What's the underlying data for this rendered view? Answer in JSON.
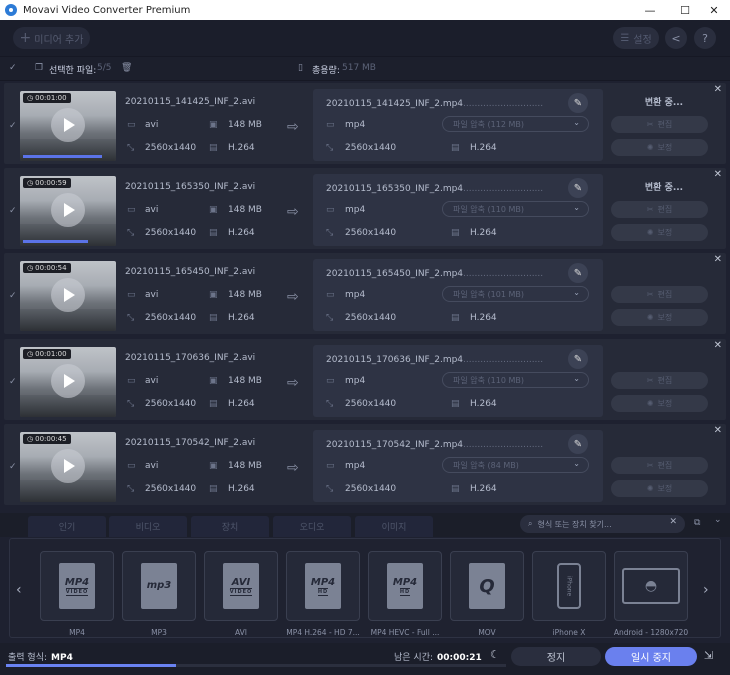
{
  "window": {
    "title": "Movavi Video Converter Premium",
    "minimize": "—",
    "maximize": "☐",
    "close": "✕"
  },
  "toolbar": {
    "add_media": "미디어 추가",
    "settings": "설정"
  },
  "selection": {
    "selected_label": "선택한 파일:",
    "selected_value": "5/5",
    "total_label": "총용량:",
    "total_value": "517 MB"
  },
  "files": [
    {
      "duration": "00:01:00",
      "name": "20210115_141425_INF_2.avi",
      "format": "avi",
      "size": "148 MB",
      "resolution": "2560x1440",
      "codec": "H.264",
      "out_name": "20210115_141425_INF_2.mp4",
      "out_format": "mp4",
      "compress": "파일 압축 (112 MB)",
      "out_resolution": "2560x1440",
      "out_codec": "H.264",
      "status": "변환 중...",
      "edit": "편집",
      "enhance": "보정",
      "progress": 0.88
    },
    {
      "duration": "00:00:59",
      "name": "20210115_165350_INF_2.avi",
      "format": "avi",
      "size": "148 MB",
      "resolution": "2560x1440",
      "codec": "H.264",
      "out_name": "20210115_165350_INF_2.mp4",
      "out_format": "mp4",
      "compress": "파일 압축 (110 MB)",
      "out_resolution": "2560x1440",
      "out_codec": "H.264",
      "status": "변환 중...",
      "edit": "편집",
      "enhance": "보정",
      "progress": 0.72
    },
    {
      "duration": "00:00:54",
      "name": "20210115_165450_INF_2.avi",
      "format": "avi",
      "size": "148 MB",
      "resolution": "2560x1440",
      "codec": "H.264",
      "out_name": "20210115_165450_INF_2.mp4",
      "out_format": "mp4",
      "compress": "파일 압축 (101 MB)",
      "out_resolution": "2560x1440",
      "out_codec": "H.264",
      "status": "",
      "edit": "편집",
      "enhance": "보정",
      "progress": 0
    },
    {
      "duration": "00:01:00",
      "name": "20210115_170636_INF_2.avi",
      "format": "avi",
      "size": "148 MB",
      "resolution": "2560x1440",
      "codec": "H.264",
      "out_name": "20210115_170636_INF_2.mp4",
      "out_format": "mp4",
      "compress": "파일 압축 (110 MB)",
      "out_resolution": "2560x1440",
      "out_codec": "H.264",
      "status": "",
      "edit": "편집",
      "enhance": "보정",
      "progress": 0
    },
    {
      "duration": "00:00:45",
      "name": "20210115_170542_INF_2.avi",
      "format": "avi",
      "size": "148 MB",
      "resolution": "2560x1440",
      "codec": "H.264",
      "out_name": "20210115_170542_INF_2.mp4",
      "out_format": "mp4",
      "compress": "파일 압축 (84 MB)",
      "out_resolution": "2560x1440",
      "out_codec": "H.264",
      "status": "",
      "edit": "편집",
      "enhance": "보정",
      "progress": 0
    }
  ],
  "tabs": [
    "인기",
    "비디오",
    "장치",
    "오디오",
    "이미지"
  ],
  "search": {
    "placeholder": "형식 또는 장치 찾기..."
  },
  "formats": [
    {
      "label": "MP4",
      "icon": "MP4",
      "sub": "VIDEO"
    },
    {
      "label": "MP3",
      "icon": "mp3",
      "sub": ""
    },
    {
      "label": "AVI",
      "icon": "AVI",
      "sub": "VIDEO"
    },
    {
      "label": "MP4 H.264 - HD 7...",
      "icon": "MP4",
      "sub": "HD"
    },
    {
      "label": "MP4 HEVC - Full ...",
      "icon": "MP4",
      "sub": "HD"
    },
    {
      "label": "MOV",
      "icon": "Q",
      "sub": ""
    },
    {
      "label": "iPhone X",
      "icon": "iPhone",
      "sub": ""
    },
    {
      "label": "Android - 1280x720",
      "icon": "android",
      "sub": ""
    }
  ],
  "bottom": {
    "output_label": "출력 형식:",
    "output_value": "MP4",
    "remaining_label": "남은 시간:",
    "remaining_value": "00:00:21",
    "stop": "정지",
    "pause": "일시 중지",
    "total_progress": 0.34
  },
  "colors": {
    "accent": "#6a80ee",
    "background": "#1e2130",
    "row": "#262a38"
  }
}
